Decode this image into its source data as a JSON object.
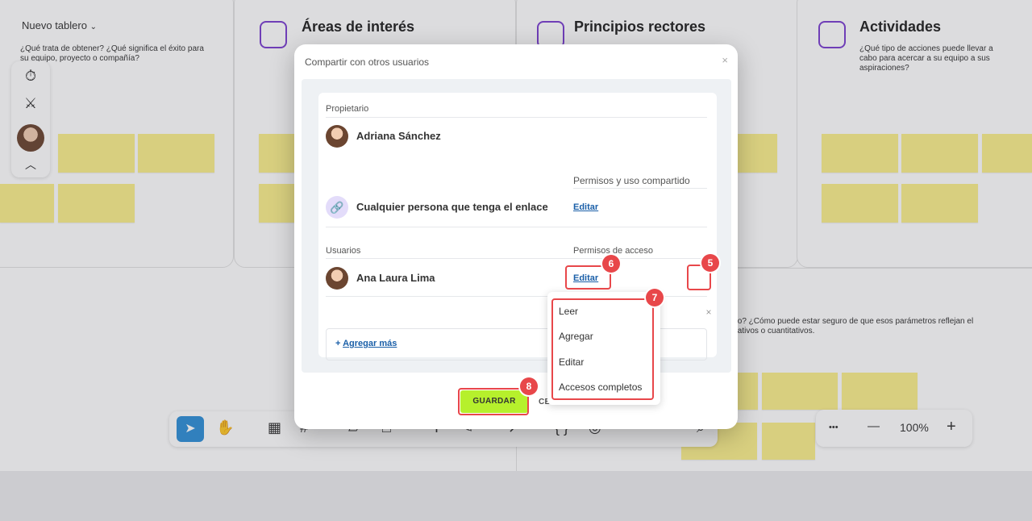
{
  "board": {
    "name": "Nuevo tablero",
    "sections": [
      {
        "title": "",
        "desc": "¿Qué trata de obtener? ¿Qué significa el éxito para su equipo, proyecto o compañía?"
      },
      {
        "title": "Áreas de interés",
        "desc": ""
      },
      {
        "title": "Principios rectores",
        "desc": ""
      },
      {
        "title": "Actividades",
        "desc": "¿Qué tipo de acciones puede llevar a cabo para acercar a su equipo a sus aspiraciones?"
      }
    ],
    "metrics_desc_line1": "to? ¿Cómo puede estar seguro de que esos parámetros reflejan el",
    "metrics_desc_line2": "tativos o cuantitativos."
  },
  "zoom": {
    "more_label": "•••",
    "minus": "—",
    "level": "100%",
    "plus": "+"
  },
  "modal": {
    "title": "Compartir con otros usuarios",
    "close": "×",
    "owner_label": "Propietario",
    "owner_name": "Adriana Sánchez",
    "permissions_sharing_label": "Permisos y uso compartido",
    "link_text": "Cualquier persona que tenga el enlace",
    "edit_label": "Editar",
    "users_label": "Usuarios",
    "access_label": "Permisos de acceso",
    "user_name": "Ana Laura Lima",
    "user_edit_label": "Editar",
    "remove_user": "×",
    "add_more_plus": "+",
    "add_more": "Agregar más",
    "save": "GUARDAR",
    "cancel": "CE"
  },
  "dropdown": {
    "items": [
      "Leer",
      "Agregar",
      "Editar",
      "Accesos completos"
    ]
  },
  "tutorial_badges": [
    "5",
    "6",
    "7",
    "8"
  ],
  "colors": {
    "highlight": "#e8474a",
    "save_button": "#b6f02c",
    "link": "#1a5fa8",
    "sticky": "#fbef8c",
    "accent_icon": "#7b3fd0"
  }
}
